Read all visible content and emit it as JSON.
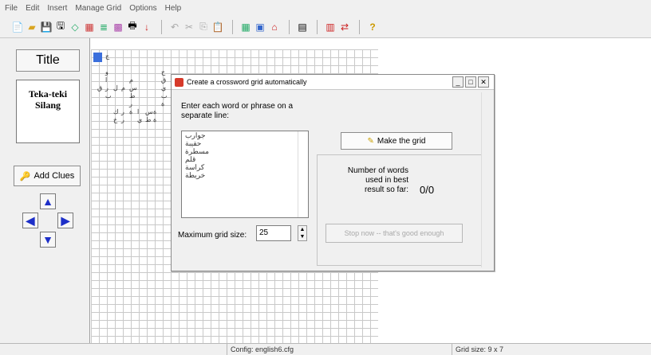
{
  "menu": [
    "File",
    "Edit",
    "Insert",
    "Manage Grid",
    "Options",
    "Help"
  ],
  "left_panel": {
    "title_button": "Title",
    "title_text_line1": "Teka-teki",
    "title_text_line2": "Silang",
    "add_clues_button": "Add Clues"
  },
  "dialog": {
    "title": "Create a crossword grid automatically",
    "instruction_line1": "Enter each word or phrase on a",
    "instruction_line2": "separate line:",
    "words": [
      "جوارب",
      "حقيبة",
      "مسطرة",
      "قلم",
      "كراسة",
      "خريطة"
    ],
    "max_grid_label": "Maximum grid size:",
    "max_grid_value": "25",
    "make_grid_button": "Make the grid",
    "number_label_line1": "Number of words",
    "number_label_line2": "used in best",
    "number_label_line3": "result so far:",
    "number_value": "0/0",
    "stop_button": "Stop now -- that's good enough"
  },
  "status": {
    "config": "Config: english6.cfg",
    "grid_size": "Grid size: 9 x 7"
  },
  "grid_letters": [
    "ج",
    "و",
    "ا",
    "ر",
    "ب",
    "ح",
    "ق",
    "ي",
    "ب",
    "ة",
    "م",
    "س",
    "ط",
    "ر",
    "ة",
    "ق",
    "ل",
    "م",
    "ك",
    "ر",
    "ا",
    "س",
    "ة",
    "خ",
    "ر",
    "ي",
    "ط",
    "ة"
  ],
  "colors": {
    "highlight": "#3b6fdc",
    "arrow": "#1d2fc8",
    "dialog_icon": "#d63a2a"
  }
}
